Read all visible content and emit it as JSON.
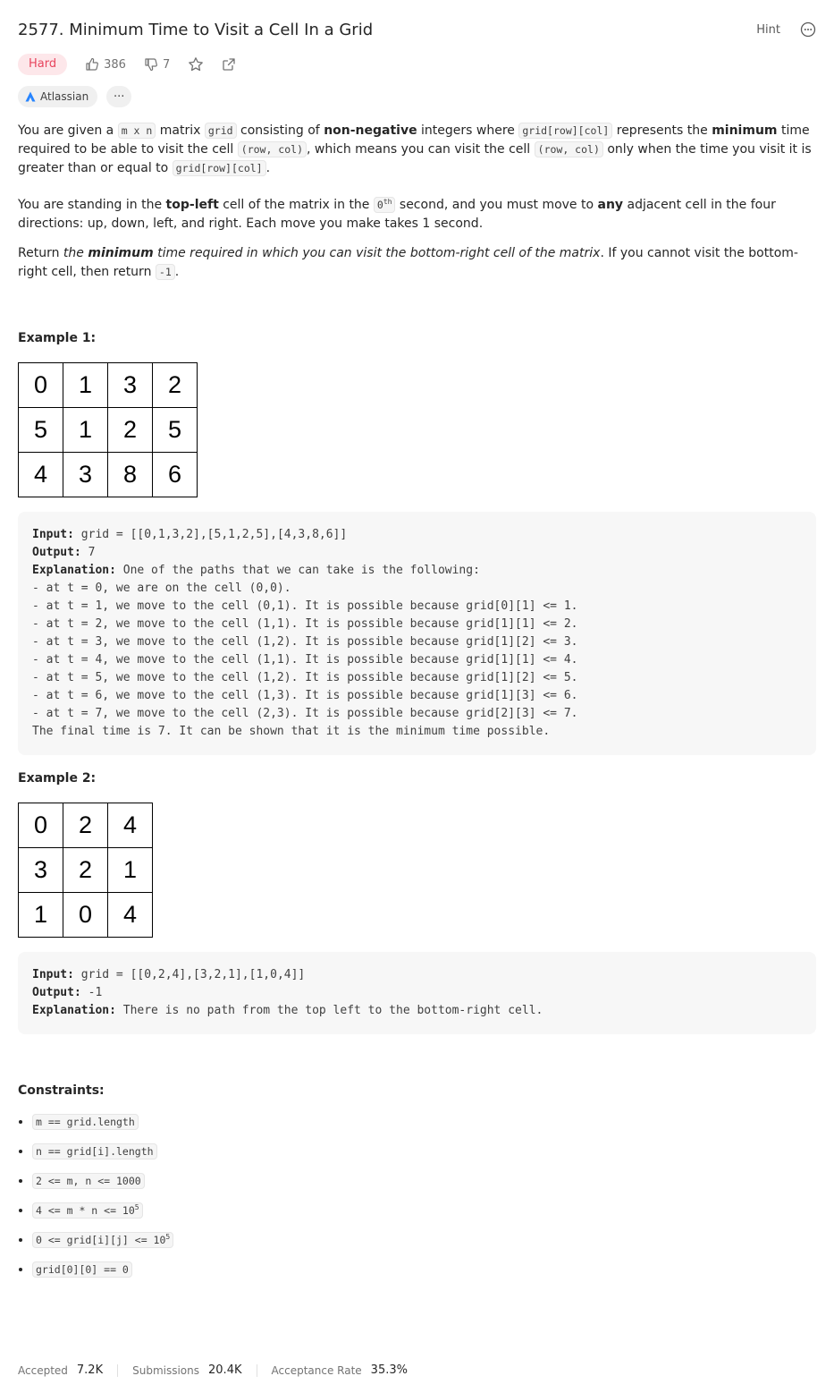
{
  "problem": {
    "title": "2577. Minimum Time to Visit a Cell In a Grid",
    "hint_label": "Hint",
    "difficulty": "Hard",
    "likes": "386",
    "dislikes": "7",
    "company": "Atlassian",
    "more_tags": "···"
  },
  "description": {
    "p1": [
      "You are given a ",
      "m x n",
      " matrix ",
      "grid",
      " consisting of ",
      "non-negative",
      " integers where ",
      "grid[row][col]",
      " represents the ",
      "minimum",
      " time required to be able to visit the cell ",
      "(row, col)",
      ", which means you can visit the cell ",
      "(row, col)",
      " only when the time you visit it is greater than or equal to ",
      "grid[row][col]",
      "."
    ],
    "p2": [
      "You are standing in the ",
      "top-left",
      " cell of the matrix in the ",
      "0",
      "th",
      " second, and you must move to ",
      "any",
      " adjacent cell in the four directions: up, down, left, and right. Each move you make takes 1 second."
    ],
    "p3": [
      "Return ",
      "the ",
      "minimum",
      " time required in which you can visit the bottom-right cell of the matrix",
      ". If you cannot visit the bottom-right cell, then return ",
      "-1",
      "."
    ]
  },
  "example1": {
    "heading": "Example 1:",
    "grid": [
      [
        "0",
        "1",
        "3",
        "2"
      ],
      [
        "5",
        "1",
        "2",
        "5"
      ],
      [
        "4",
        "3",
        "8",
        "6"
      ]
    ],
    "input_label": "Input:",
    "input": " grid = [[0,1,3,2],[5,1,2,5],[4,3,8,6]]",
    "output_label": "Output:",
    "output": " 7",
    "explanation_label": "Explanation:",
    "explanation": " One of the paths that we can take is the following:",
    "lines": [
      "- at t = 0, we are on the cell (0,0).",
      "- at t = 1, we move to the cell (0,1). It is possible because grid[0][1] <= 1.",
      "- at t = 2, we move to the cell (1,1). It is possible because grid[1][1] <= 2.",
      "- at t = 3, we move to the cell (1,2). It is possible because grid[1][2] <= 3.",
      "- at t = 4, we move to the cell (1,1). It is possible because grid[1][1] <= 4.",
      "- at t = 5, we move to the cell (1,2). It is possible because grid[1][2] <= 5.",
      "- at t = 6, we move to the cell (1,3). It is possible because grid[1][3] <= 6.",
      "- at t = 7, we move to the cell (2,3). It is possible because grid[2][3] <= 7.",
      "The final time is 7. It can be shown that it is the minimum time possible."
    ]
  },
  "example2": {
    "heading": "Example 2:",
    "grid": [
      [
        "0",
        "2",
        "4"
      ],
      [
        "3",
        "2",
        "1"
      ],
      [
        "1",
        "0",
        "4"
      ]
    ],
    "input_label": "Input:",
    "input": " grid = [[0,2,4],[3,2,1],[1,0,4]]",
    "output_label": "Output:",
    "output": " -1",
    "explanation_label": "Explanation:",
    "explanation": " There is no path from the top left to the bottom-right cell."
  },
  "constraints": {
    "heading": "Constraints:",
    "items": [
      {
        "text": "m == grid.length",
        "sup": ""
      },
      {
        "text": "n == grid[i].length",
        "sup": ""
      },
      {
        "text": "2 <= m, n <= 1000",
        "sup": ""
      },
      {
        "text": "4 <= m * n <= 10",
        "sup": "5"
      },
      {
        "text": "0 <= grid[i][j] <= 10",
        "sup": "5"
      },
      {
        "text": "grid[0][0] == 0",
        "sup": ""
      }
    ]
  },
  "stats": {
    "accepted_label": "Accepted",
    "accepted": "7.2K",
    "submissions_label": "Submissions",
    "submissions": "20.4K",
    "rate_label": "Acceptance Rate",
    "rate": "35.3%"
  },
  "colors": {
    "hard_text": "#e8455e",
    "hard_bg": "#fde7ea",
    "atlassian_blue": "#2684ff"
  }
}
